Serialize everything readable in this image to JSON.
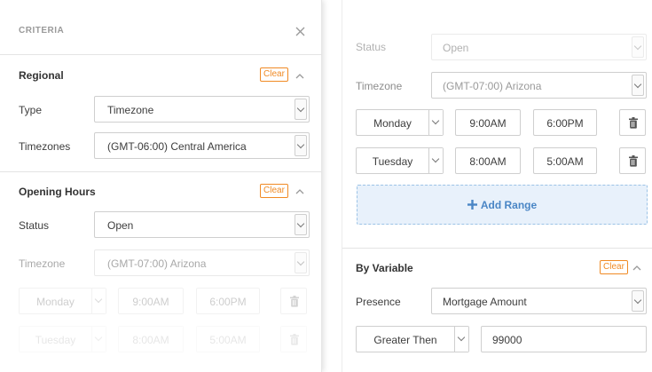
{
  "criteria": {
    "title": "CRITERIA",
    "regional": {
      "title": "Regional",
      "clear": "Clear",
      "type_label": "Type",
      "type_value": "Timezone",
      "timezones_label": "Timezones",
      "timezones_value": "(GMT-06:00) Central America"
    },
    "opening_hours": {
      "title": "Opening Hours",
      "clear": "Clear",
      "status_label": "Status",
      "status_value": "Open",
      "timezone_label": "Timezone",
      "timezone_value": "(GMT-07:00) Arizona",
      "ranges": [
        {
          "day": "Monday",
          "start": "9:00AM",
          "end": "6:00PM"
        },
        {
          "day": "Tuesday",
          "start": "8:00AM",
          "end": "5:00AM"
        }
      ]
    }
  },
  "back": {
    "status_label": "Status",
    "status_value": "Open",
    "timezone_label": "Timezone",
    "timezone_value": "(GMT-07:00) Arizona",
    "ranges": [
      {
        "day": "Monday",
        "start": "9:00AM",
        "end": "6:00PM"
      },
      {
        "day": "Tuesday",
        "start": "8:00AM",
        "end": "5:00AM"
      }
    ],
    "add_range": "Add Range",
    "by_variable": {
      "title": "By Variable",
      "clear": "Clear",
      "presence_label": "Presence",
      "presence_value": "Mortgage Amount",
      "operator_value": "Greater Then",
      "amount_value": "99000"
    }
  },
  "colors": {
    "accent_orange": "#f08a24",
    "link_blue": "#4a86c5",
    "add_range_bg": "#e8f1fb"
  },
  "icons": [
    "close-icon",
    "chevron-up-icon",
    "chevron-down-icon",
    "trash-icon",
    "plus-icon"
  ]
}
